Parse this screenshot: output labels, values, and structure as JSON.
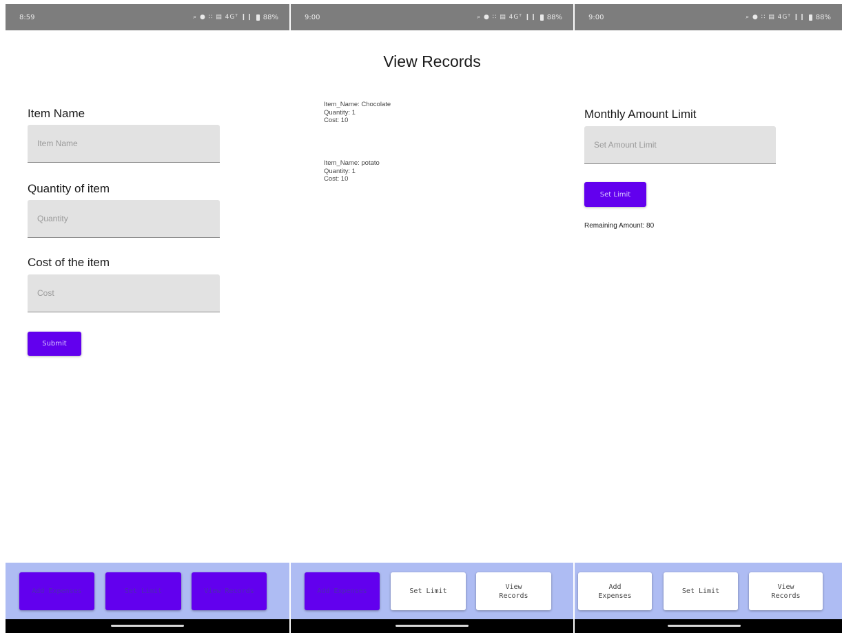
{
  "screens": [
    {
      "status": {
        "time": "8:59",
        "right_icons": "⌕ ● ∷ ▤ 4Gᵀ ❙❙",
        "battery": "88%"
      },
      "form": {
        "item_name_label": "Item Name",
        "item_name_placeholder": "Item Name",
        "quantity_label": "Quantity of item",
        "quantity_placeholder": "Quantity",
        "cost_label": "Cost of the item",
        "cost_placeholder": "Cost",
        "submit_label": "Submit"
      },
      "nav": {
        "add_expenses": "Add Expenses",
        "set_limit": "Set Limit",
        "view_records": "View Records",
        "active": "all"
      }
    },
    {
      "status": {
        "time": "9:00",
        "right_icons": "⌕ ● ∷ ▤ 4Gᵀ ❙❙",
        "battery": "88%"
      },
      "title": "View Records",
      "records": [
        {
          "item": "Item_Name: Chocolate",
          "quantity": "Quantity: 1",
          "cost": "Cost: 10"
        },
        {
          "item": "Item_Name: potato",
          "quantity": "Quantity: 1",
          "cost": "Cost: 10"
        }
      ],
      "nav": {
        "add_expenses": "Add Expenses",
        "set_limit": "Set Limit",
        "view_records": "View\nRecords",
        "active": "add_expenses"
      }
    },
    {
      "status": {
        "time": "9:00",
        "right_icons": "⌕ ● ∷ ▤ 4Gᵀ ❙❙",
        "battery": "88%"
      },
      "limit": {
        "label": "Monthly Amount Limit",
        "placeholder": "Set Amount Limit",
        "button_label": "Set Limit",
        "remaining": "Remaining Amount: 80"
      },
      "nav": {
        "add_expenses": "Add\nExpenses",
        "set_limit": "Set Limit",
        "view_records": "View\nRecords",
        "active": "none"
      }
    }
  ],
  "colors": {
    "accent": "#6200ee",
    "nav_background": "#aebcf3",
    "status_bar": "#7d7d7d",
    "input_fill": "#e2e2e2"
  }
}
